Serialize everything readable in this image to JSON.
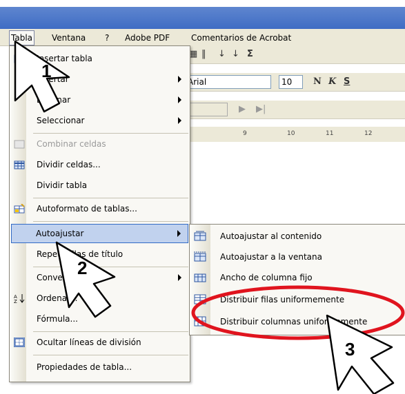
{
  "menubar": {
    "items": [
      {
        "label": "Tabla"
      },
      {
        "label": "Ventana"
      },
      {
        "label": "?"
      },
      {
        "label": "Adobe PDF"
      },
      {
        "label": "Comentarios de Acrobat"
      }
    ]
  },
  "toolbar": {
    "font_name": "Arial",
    "font_size": "10",
    "bold": "N",
    "italic": "K",
    "underline": "S",
    "sum": "Σ",
    "ruler_ticks": [
      "9",
      "10",
      "11",
      "12"
    ]
  },
  "menu": {
    "items": [
      {
        "label": "Insertar tabla",
        "shown": "Insertar tabla"
      },
      {
        "label": "Insertar"
      },
      {
        "label": "Eliminar"
      },
      {
        "label": "Seleccionar"
      },
      {
        "label": "Combinar celdas"
      },
      {
        "label": "Dividir celdas..."
      },
      {
        "label": "Dividir tabla"
      },
      {
        "label": "Autoformato de tablas..."
      },
      {
        "label": "Autoajustar"
      },
      {
        "label": "Repetir filas de título"
      },
      {
        "label": "Convertir"
      },
      {
        "label": "Ordenar..."
      },
      {
        "label": "Fórmula..."
      },
      {
        "label": "Ocultar líneas de división"
      },
      {
        "label": "Propiedades de tabla..."
      }
    ]
  },
  "submenu": {
    "items": [
      {
        "label": "Autoajustar al contenido"
      },
      {
        "label": "Autoajustar a la ventana"
      },
      {
        "label": "Ancho de columna fijo"
      },
      {
        "label": "Distribuir filas uniformemente"
      },
      {
        "label": "Distribuir columnas uniformemente"
      }
    ]
  },
  "callouts": [
    "1",
    "2",
    "3"
  ],
  "colors": {
    "highlight": "#c1d2ee",
    "highlight_border": "#316ac5",
    "ellipse": "#e0141e",
    "titlebar": "#4a76c8"
  }
}
